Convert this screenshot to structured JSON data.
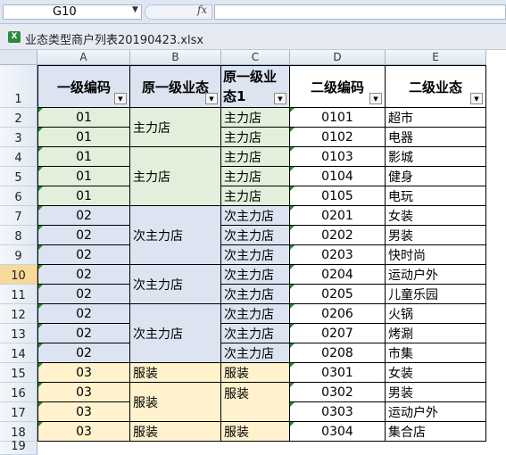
{
  "formula_bar": {
    "name_box": "G10",
    "fx_label": "fx",
    "formula": ""
  },
  "window": {
    "title": "业态类型商户列表20190423.xlsx"
  },
  "columns": [
    "A",
    "B",
    "C",
    "D",
    "E"
  ],
  "rows": [
    "1",
    "2",
    "3",
    "4",
    "5",
    "6",
    "7",
    "8",
    "9",
    "10",
    "11",
    "12",
    "13",
    "14",
    "15",
    "16",
    "17",
    "18",
    "19"
  ],
  "selected_row": "10",
  "headers": {
    "a": "一级编码",
    "b": "原一级业态",
    "c": "原一级业态1",
    "d": "二级编码",
    "e": "二级业态"
  },
  "code1": [
    "01",
    "01",
    "01",
    "01",
    "01",
    "02",
    "02",
    "02",
    "02",
    "02",
    "02",
    "02",
    "02",
    "03",
    "03",
    "03",
    "03"
  ],
  "orig": [
    "主力店",
    "主力店",
    "次主力店",
    "次主力店",
    "次主力店",
    "服装",
    "服装",
    "服装"
  ],
  "orig1": [
    "主力店",
    "主力店",
    "主力店",
    "主力店",
    "主力店",
    "次主力店",
    "次主力店",
    "次主力店",
    "次主力店",
    "次主力店",
    "次主力店",
    "次主力店",
    "次主力店",
    "服装",
    "服装",
    "服装"
  ],
  "code2": [
    "0101",
    "0102",
    "0103",
    "0104",
    "0105",
    "0201",
    "0202",
    "0203",
    "0204",
    "0205",
    "0206",
    "0207",
    "0208",
    "0301",
    "0302",
    "0303",
    "0304"
  ],
  "cat2": [
    "超市",
    "电器",
    "影城",
    "健身",
    "电玩",
    "女装",
    "男装",
    "快时尚",
    "运动户外",
    "儿童乐园",
    "火锅",
    "烤涮",
    "市集",
    "女装",
    "男装",
    "运动户外",
    "集合店"
  ],
  "colors": {
    "green": "#e2efda",
    "blue": "#dce4f1",
    "yellow": "#fff2cc",
    "header_bg": "#dce4f1",
    "selected_row": "#f8d99a"
  }
}
